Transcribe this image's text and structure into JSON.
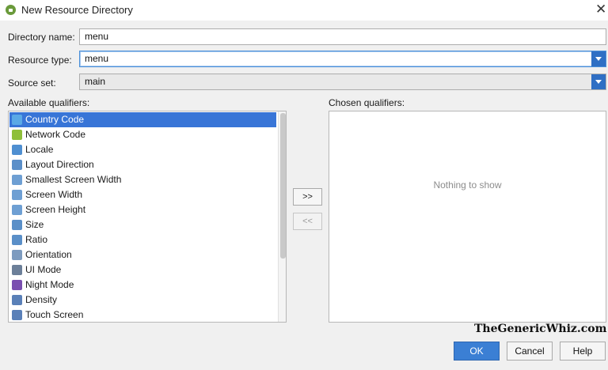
{
  "window": {
    "title": "New Resource Directory",
    "close_glyph": "✕"
  },
  "form": {
    "directory_name_label": "Directory name:",
    "directory_name_value": "menu",
    "resource_type_label": "Resource type:",
    "resource_type_value": "menu",
    "source_set_label": "Source set:",
    "source_set_value": "main"
  },
  "available": {
    "label": "Available qualifiers:",
    "items": [
      {
        "label": "Country Code",
        "icon": "country-code-icon",
        "color": "#5aa9e6"
      },
      {
        "label": "Network Code",
        "icon": "network-code-icon",
        "color": "#8fbf3a"
      },
      {
        "label": "Locale",
        "icon": "locale-icon",
        "color": "#4f8fd1"
      },
      {
        "label": "Layout Direction",
        "icon": "layout-direction-icon",
        "color": "#5b8fc9"
      },
      {
        "label": "Smallest Screen Width",
        "icon": "smallest-width-icon",
        "color": "#6e9fd3"
      },
      {
        "label": "Screen Width",
        "icon": "screen-width-icon",
        "color": "#6e9fd3"
      },
      {
        "label": "Screen Height",
        "icon": "screen-height-icon",
        "color": "#6e9fd3"
      },
      {
        "label": "Size",
        "icon": "size-icon",
        "color": "#5a8fc8"
      },
      {
        "label": "Ratio",
        "icon": "ratio-icon",
        "color": "#5a8fc8"
      },
      {
        "label": "Orientation",
        "icon": "orientation-icon",
        "color": "#7d9bbf"
      },
      {
        "label": "UI Mode",
        "icon": "ui-mode-icon",
        "color": "#6c7f99"
      },
      {
        "label": "Night Mode",
        "icon": "night-mode-icon",
        "color": "#7a4fb0"
      },
      {
        "label": "Density",
        "icon": "density-icon",
        "color": "#5a80b8"
      },
      {
        "label": "Touch Screen",
        "icon": "touch-screen-icon",
        "color": "#5a80b8"
      }
    ],
    "selected_index": 0
  },
  "chosen": {
    "label": "Chosen qualifiers:",
    "empty_text": "Nothing to show"
  },
  "move_buttons": {
    "add": ">>",
    "remove": "<<"
  },
  "watermark": "TheGenericWhiz.com",
  "buttons": {
    "ok": "OK",
    "cancel": "Cancel",
    "help": "Help"
  }
}
